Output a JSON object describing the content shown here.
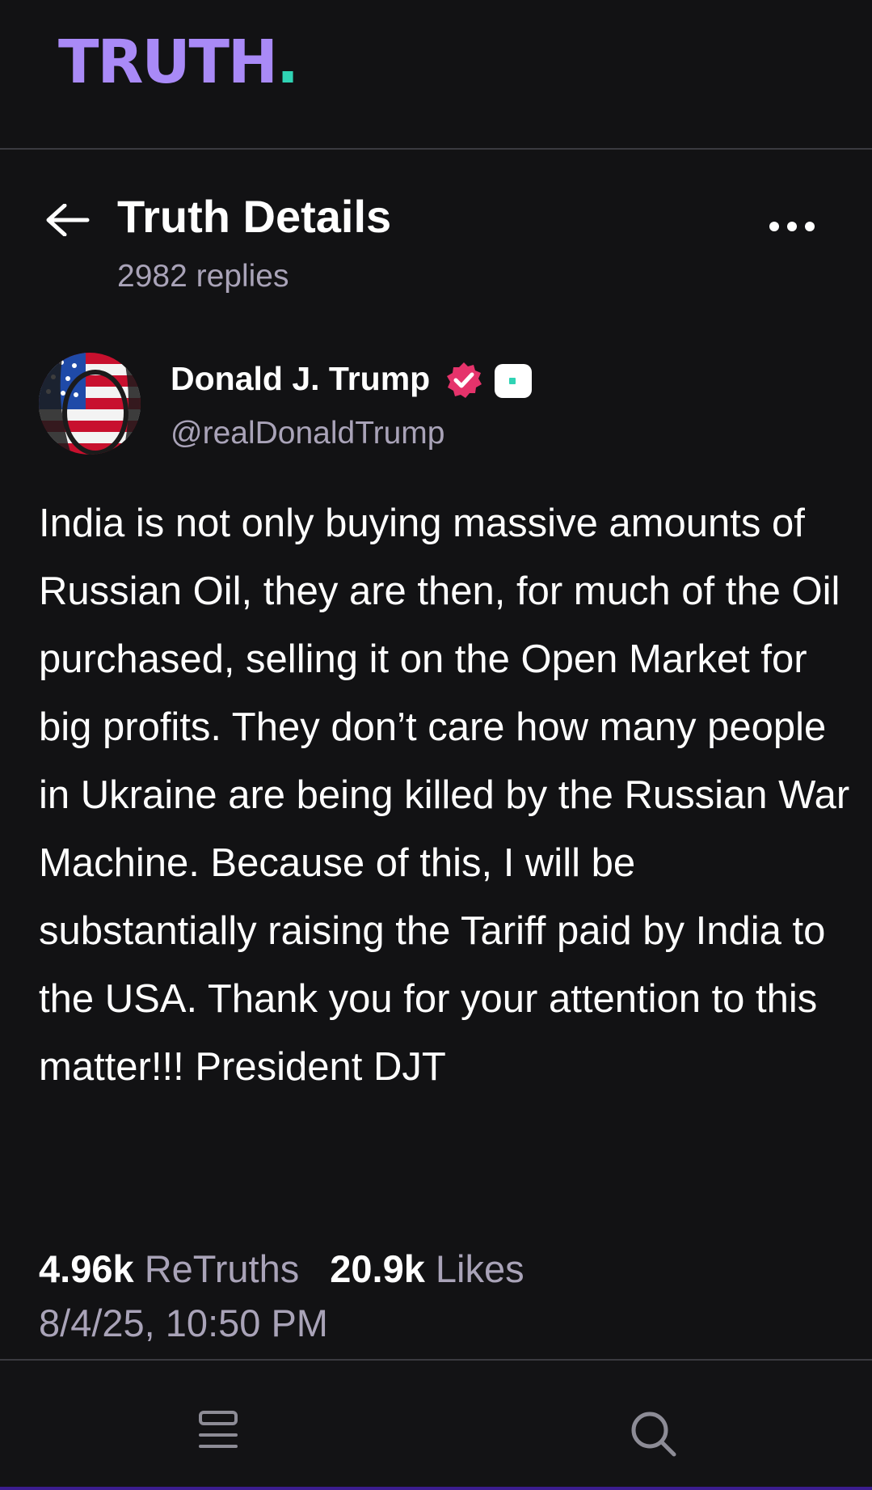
{
  "brand": {
    "logo_text": "TRUTH",
    "logo_dot": ".",
    "logo_color": "#a98af7",
    "accent_color": "#2fd3b4"
  },
  "header": {
    "title": "Truth Details",
    "subtitle": "2982 replies",
    "back_icon": "arrow-left-icon",
    "more_icon": "more-horizontal-icon"
  },
  "author": {
    "name": "Donald J. Trump",
    "handle": "@realDonaldTrump",
    "verified_icon": "verified-badge-icon",
    "verified_color": "#e5336b"
  },
  "post": {
    "text": "India is not only buying massive amounts of Russian Oil, they are then, for much of the Oil purchased, selling it on the Open Market for big profits. They don’t care how many people in Ukraine are being killed by the Russian War Machine. Because of this, I will be substantially raising the Tariff paid by India to the USA. Thank you for your attention to this matter!!! President DJT"
  },
  "stats": {
    "retruths_count": "4.96k",
    "retruths_label": "ReTruths",
    "likes_count": "20.9k",
    "likes_label": "Likes",
    "timestamp": "8/4/25, 10:50 PM"
  },
  "bottom_nav": [
    {
      "icon": "feed-icon"
    },
    {
      "icon": "search-icon"
    }
  ]
}
